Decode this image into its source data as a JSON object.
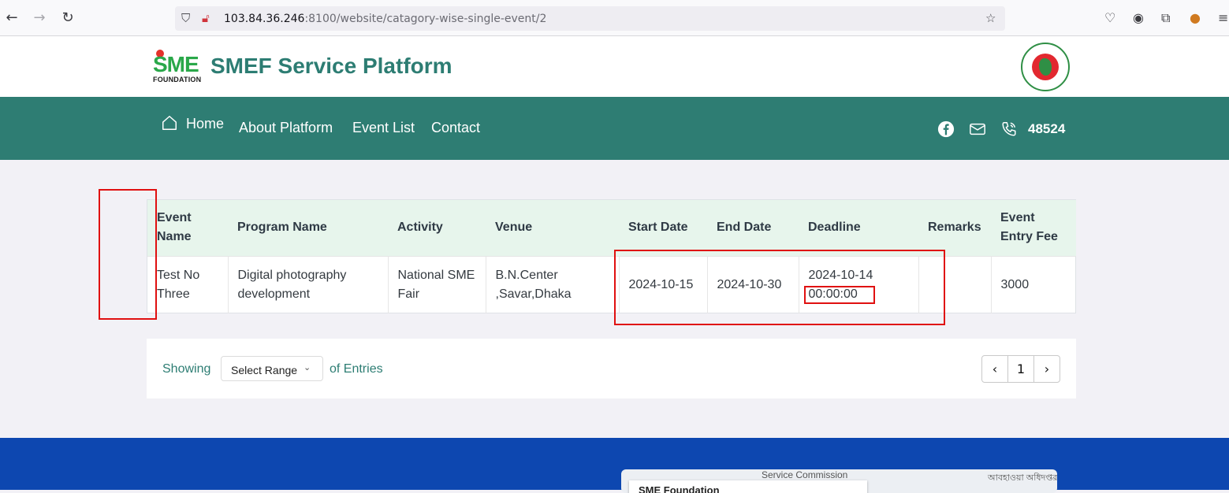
{
  "browser": {
    "url_host": "103.84.36.246",
    "url_rest": ":8100/website/catagory-wise-single-event/2"
  },
  "header": {
    "logo_sme": "SME",
    "logo_foundation": "FOUNDATION",
    "title": "SMEF Service Platform"
  },
  "nav": {
    "home": "Home",
    "about": "About Platform",
    "events": "Event List",
    "contact": "Contact",
    "phone": "48524"
  },
  "table": {
    "headers": [
      "Event Name",
      "Program Name",
      "Activity",
      "Venue",
      "Start Date",
      "End Date",
      "Deadline",
      "Remarks",
      "Event Entry Fee"
    ],
    "rows": [
      {
        "event_name": "Test No Three",
        "program_name": "Digital photography development",
        "activity": "National SME Fair",
        "venue": "B.N.Center ,Savar,Dhaka",
        "start_date": "2024-10-15",
        "end_date": "2024-10-30",
        "deadline_date": "2024-10-14",
        "deadline_time": "00:00:00",
        "remarks": "",
        "entry_fee": "3000"
      }
    ]
  },
  "pagination": {
    "showing": "Showing",
    "select_placeholder": "Select Range",
    "of_entries": "of Entries",
    "current_page": "1"
  },
  "footer": {
    "map_label_1": "Service Commission",
    "map_label_2": "আবহাওয়া অধিদপ্তর",
    "map_box_title": "SME Foundation"
  },
  "colors": {
    "brand_teal": "#2e7d73",
    "header_row": "#e7f5ec",
    "footer_blue": "#0d47b0",
    "annotation_red": "#e01010"
  }
}
